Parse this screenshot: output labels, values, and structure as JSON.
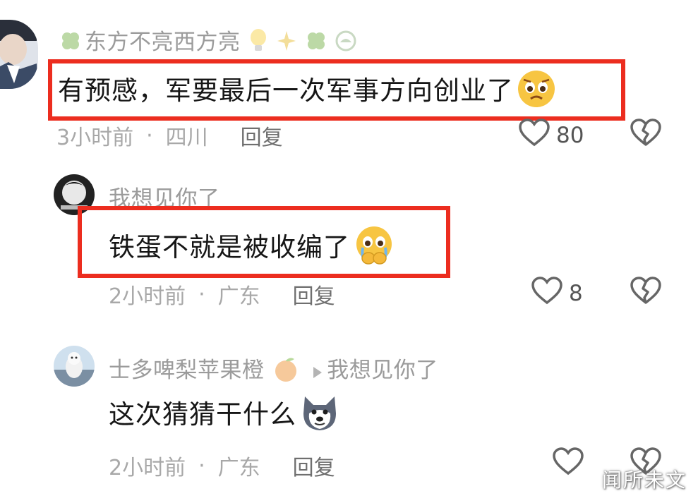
{
  "comments": [
    {
      "username": "东方不亮西方亮",
      "text": "有预感，军要最后一次军事方向创业了",
      "time": "3小时前",
      "location": "四川",
      "reply_label": "回复",
      "likes": "80"
    },
    {
      "username": "我想见你了",
      "text": "铁蛋不就是被收编了",
      "time": "2小时前",
      "location": "广东",
      "reply_label": "回复",
      "likes": "8"
    },
    {
      "username": "士多啤梨苹果橙",
      "reply_to": "我想见你了",
      "text": "这次猜猜干什么",
      "time": "2小时前",
      "location": "广东",
      "reply_label": "回复",
      "likes": ""
    }
  ],
  "separator": "·",
  "watermark": "闻所未文",
  "colors": {
    "highlight_box": "#ec2d1f",
    "username": "#9b9b9b",
    "text": "#161616"
  },
  "icons": [
    "heart-icon",
    "dislike-broken-heart-icon",
    "clover-icon",
    "lightbulb-icon",
    "sparkle-icon",
    "orange-icon",
    "play-arrow-icon",
    "pleading-face-emoji",
    "husky-emoji"
  ]
}
